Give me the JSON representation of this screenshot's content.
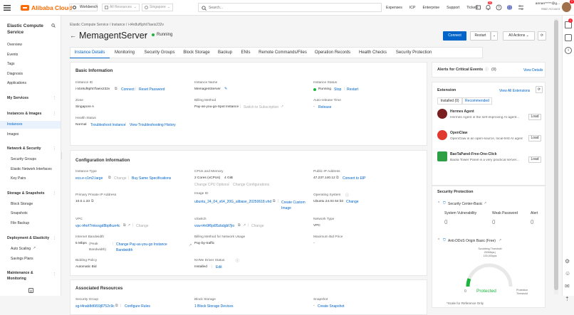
{
  "topbar": {
    "logo": "Alibaba Cloud",
    "workbench": "Workbench",
    "all_resources": "All Resources",
    "region": "Singapore",
    "search_placeholder": "Search...",
    "links": [
      "Expenses",
      "ICP",
      "Enterprise",
      "Support",
      "Tickets"
    ],
    "notif_count": "30",
    "user_name": "annan*****@g...",
    "user_role": "Main Account"
  },
  "sidebar": {
    "title": "Elastic Compute Service",
    "top_items": [
      "Overview",
      "Events",
      "Tags",
      "Diagnosis",
      "Applications"
    ],
    "groups": [
      {
        "label": "My Services"
      },
      {
        "label": "Instances & Images",
        "items": [
          "Instances",
          "Images"
        ]
      },
      {
        "label": "Network & Security",
        "items": [
          "Security Groups",
          "Elastic Network Interfaces",
          "Key Pairs"
        ]
      },
      {
        "label": "Storage & Snapshots",
        "items": [
          "Block Storage",
          "Snapshots",
          "File Backup"
        ]
      },
      {
        "label": "Deployment & Elasticity",
        "items": [
          "Auto Scaling",
          "Savings Plans"
        ]
      },
      {
        "label": "Maintenance & Monitoring"
      }
    ]
  },
  "breadcrumb": [
    "Elastic Compute Service",
    "Instance",
    "i-t4n8uf6pht7laeix232v"
  ],
  "header": {
    "title": "MemagentServer",
    "status": "Running",
    "connect": "Connect",
    "restart": "Restart",
    "all_actions": "All Actions"
  },
  "tabs": [
    "Instance Details",
    "Monitoring",
    "Security Groups",
    "Block Storage",
    "Backup",
    "ENIs",
    "Remote Commands/Files",
    "Operation Records",
    "Health Checks",
    "Security Protection"
  ],
  "basic": {
    "title": "Basic Information",
    "instance_id_label": "Instance ID",
    "instance_id": "i-t4n8uf6pht7laeix232v",
    "connect": "Connect",
    "reset_password": "Reset Password",
    "name_label": "Instance Name",
    "name": "MemagentServer",
    "status_label": "Instance Status",
    "status": "Running",
    "stop": "Stop",
    "restart": "Restart",
    "zone_label": "Zone",
    "zone": "Singapore A",
    "billing_label": "Billing Method",
    "billing": "Pay-as-you-go-Spot Instance",
    "switch_sub": "Switch to Subscription",
    "auto_release_label": "Auto-release Time",
    "auto_release": "Release",
    "health_label": "Health Status",
    "health": "Normal",
    "troubleshoot": "Troubleshoot Instance",
    "view_history": "View Troubleshooting History"
  },
  "config": {
    "title": "Configuration Information",
    "type_label": "Instance Type",
    "type": "ecs.e-c1m2.large",
    "change": "Change",
    "buy_same": "Buy Same Specifications",
    "cpu_label": "CPUs and Memory",
    "cpu": "2 Cores (vCPUs)",
    "mem": "4 GiB",
    "change_cpu": "Change CPU Options",
    "change_config": "Change Configurations",
    "pubip_label": "Public IP Address",
    "pubip": "47.237.140.12",
    "convert_eip": "Convert to EIP",
    "privip_label": "Primary Private IP Address",
    "privip": "10.0.1.33",
    "image_label": "Image ID",
    "image": "ubuntu_24_04_x64_20G_alibase_20250618.vhd",
    "create_image": "Create Custom Image",
    "os_label": "Operating System",
    "os": "Ubuntu 24.04 64 bit",
    "os_change": "Change",
    "vpc_label": "VPC",
    "vpc": "vpc-t4nrf7mkvsgd8bpfkun4c",
    "vpc_change": "Change",
    "vswitch_label": "vSwitch",
    "vswitch": "vsw-t4n9f6pi85zbdgbl7jlo",
    "vswitch_change": "Change",
    "nettype_label": "Network Type",
    "nettype": "VPC",
    "bw_label": "Internet Bandwidth",
    "bw": "5 Mbps",
    "bw_peak": "(Peak Bandwidth)",
    "bw_change": "Change Pay-as-you-go Instance Bandwidth",
    "bwbill_label": "Billing Method for Network Usage",
    "bwbill": "Pay-by-traffic",
    "maxbid_label": "Maximum Bid Price",
    "maxbid": "-",
    "bidding_label": "Bidding Policy",
    "bidding": "Automatic Bid",
    "nvme_label": "NVMe Driver Status",
    "nvme": "Installed",
    "nvme_edit": "Edit"
  },
  "assoc": {
    "title": "Associated Resources",
    "sg_label": "Security Group",
    "sg": "sg-t4nab8d6t59j8752c9c",
    "sg_rules": "Configure Rules",
    "bs_label": "Block Storage",
    "bs": "1 Block Storage Devices",
    "snap_label": "Snapshot",
    "snap": "-",
    "create_snap": "Create Snapshot"
  },
  "alerts": {
    "title": "Alerts for Critical Events",
    "count": "(0)",
    "view": "View Details"
  },
  "extension": {
    "title": "Extension",
    "view_all": "View All Extensions",
    "tab_installed": "Installed (0)",
    "tab_recommended": "Recommended",
    "items": [
      {
        "name": "Hermes Agent",
        "desc": "Hermes Agent is the self-improving AI agent...",
        "action": "Load"
      },
      {
        "name": "OpenClaw",
        "desc": "OpenClaw is an open-source, local-first AI agent...",
        "action": "Load"
      },
      {
        "name": "BaoTaPanel-Free-One-Click",
        "desc": "Baota Tower Panel is a very practical server...",
        "action": "Load"
      }
    ]
  },
  "protection": {
    "title": "Security Protection",
    "center": "Security Center-Basic",
    "cols": [
      {
        "label": "System Vulnerability",
        "value": "0"
      },
      {
        "label": "Weak Password",
        "value": "0"
      },
      {
        "label": "Alert",
        "value": "0"
      }
    ],
    "ddos": "Anti-DDoS Origin Basic (Free)",
    "scrub": "Scrubbing Threshold",
    "scrub2": "200Mbps | 100,000pps",
    "protected": "Protected",
    "gauge_zero": "0",
    "thr_label": "Protection Threshold",
    "scale": "*Scale for Reference Only"
  },
  "colors": {
    "accent": "#0064c8",
    "brand": "#ff6a00",
    "running": "#1bb43a"
  }
}
